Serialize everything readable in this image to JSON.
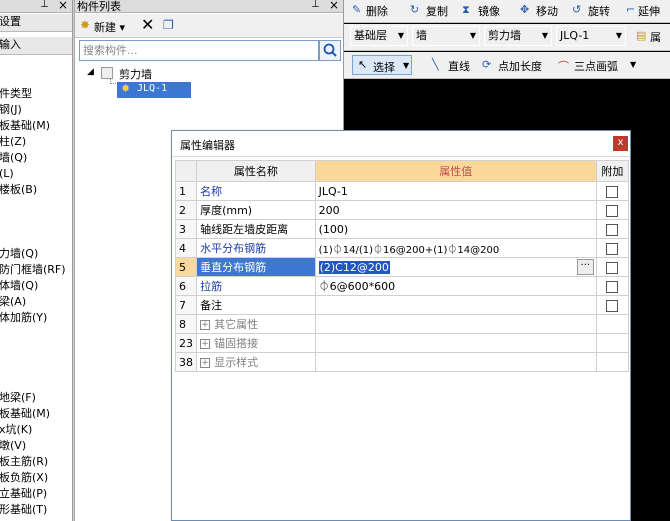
{
  "left_panel": {
    "items": [
      "设置",
      "输入",
      "件类型",
      "钢(J)",
      "板基础(M)",
      "柱(Z)",
      "墙(Q)",
      "(L)",
      "楼板(B)",
      "力墙(Q)",
      "防门框墙(RF)",
      "体墙(Q)",
      "梁(A)",
      "体加筋(Y)",
      "地梁(F)",
      "板基础(M)",
      "x坑(K)",
      "墩(V)",
      "板主筋(R)",
      "板负筋(X)",
      "立基础(P)",
      "形基础(T)"
    ]
  },
  "component_list": {
    "title": "构件列表",
    "new_label": "新建",
    "search_placeholder": "搜索构件...",
    "tree_root": "剪力墙",
    "tree_child": "JLQ-1"
  },
  "toolbar": {
    "row1": [
      "删除",
      "复制",
      "镜像",
      "移动",
      "旋转",
      "延伸"
    ],
    "row2": [
      "基础层",
      "墙",
      "剪力墙",
      "JLQ-1",
      "属"
    ],
    "row3": [
      "选择",
      "直线",
      "点加长度",
      "三点画弧"
    ]
  },
  "dialog": {
    "title": "属性编辑器",
    "close": "x",
    "headers": [
      "属性名称",
      "属性值",
      "附加"
    ],
    "rows": [
      {
        "num": "1",
        "name": "名称",
        "value": "JLQ-1"
      },
      {
        "num": "2",
        "name": "厚度(mm)",
        "value": "200"
      },
      {
        "num": "3",
        "name": "轴线距左墙皮距离",
        "value": "(100)"
      },
      {
        "num": "4",
        "name": "水平分布钢筋",
        "value": "(1)⏀14/(1)⏀16@200+(1)⏀14@200"
      },
      {
        "num": "5",
        "name": "垂直分布钢筋",
        "value": "(2)C12@200"
      },
      {
        "num": "6",
        "name": "拉筋",
        "value": "⏀6@600*600"
      },
      {
        "num": "7",
        "name": "备注",
        "value": ""
      },
      {
        "num": "8",
        "name": "其它属性",
        "value": ""
      },
      {
        "num": "23",
        "name": "锚固搭接",
        "value": ""
      },
      {
        "num": "38",
        "name": "显示样式",
        "value": ""
      }
    ]
  }
}
